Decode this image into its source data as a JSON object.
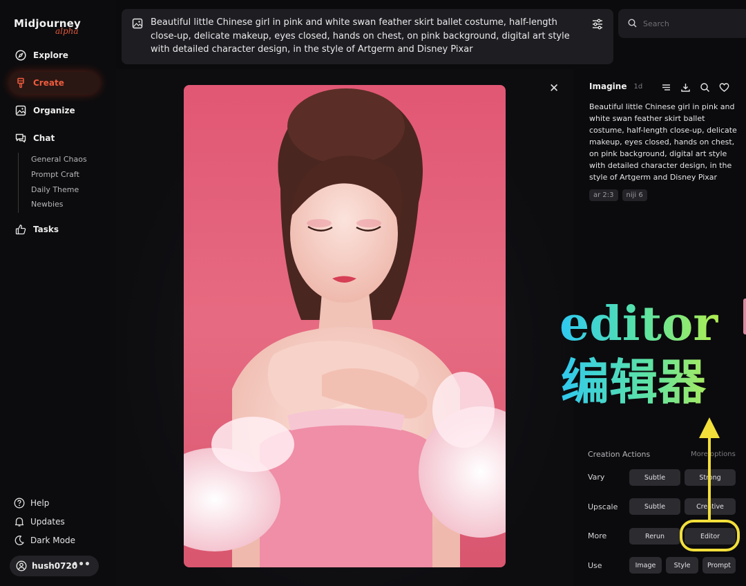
{
  "app": {
    "logo": "Midjourney",
    "logo_sub": "alpha"
  },
  "sidebar": {
    "nav": [
      {
        "label": "Explore",
        "icon": "compass-icon"
      },
      {
        "label": "Create",
        "icon": "brush-icon",
        "active": true
      },
      {
        "label": "Organize",
        "icon": "image-icon"
      },
      {
        "label": "Chat",
        "icon": "chat-icon"
      },
      {
        "label": "Tasks",
        "icon": "thumbs-up-icon"
      }
    ],
    "chat_rooms": [
      "General Chaos",
      "Prompt Craft",
      "Daily Theme",
      "Newbies"
    ],
    "footer": [
      {
        "label": "Help",
        "icon": "help-icon"
      },
      {
        "label": "Updates",
        "icon": "bell-icon"
      },
      {
        "label": "Dark Mode",
        "icon": "moon-icon"
      }
    ],
    "user": {
      "name": "hush0720",
      "menu": "•••"
    }
  },
  "prompt_bar": {
    "text": "Beautiful little Chinese girl in pink and white swan feather skirt ballet costume, half-length close-up, delicate makeup, eyes closed, hands on chest, on pink background, digital art style with detailed character design, in the style of Artgerm and Disney Pixar"
  },
  "search": {
    "placeholder": "Search"
  },
  "viewer": {
    "close": "✕"
  },
  "details": {
    "title": "Imagine",
    "age": "1d",
    "prompt": "Beautiful little Chinese girl in pink and white swan feather skirt ballet costume, half-length close-up, delicate makeup, eyes closed, hands on chest, on pink background, digital art style with detailed character design, in the style of Artgerm and Disney Pixar",
    "tags": [
      "ar 2:3",
      "niji 6"
    ]
  },
  "creation_actions": {
    "heading": "Creation Actions",
    "more_options": "More options",
    "rows": [
      {
        "label": "Vary",
        "buttons": [
          "Subtle",
          "Strong"
        ]
      },
      {
        "label": "Upscale",
        "buttons": [
          "Subtle",
          "Creative"
        ]
      },
      {
        "label": "More",
        "buttons": [
          "Rerun",
          "Editor"
        ]
      },
      {
        "label": "Use",
        "buttons": [
          "Image",
          "Style",
          "Prompt"
        ]
      }
    ]
  },
  "annotation": {
    "en": "editor",
    "cn": "编辑器",
    "color": "#f2df3a"
  },
  "colors": {
    "accent": "#ef5b3d",
    "background": "#0b0b0d",
    "artwork_bg": "#e4617a"
  }
}
